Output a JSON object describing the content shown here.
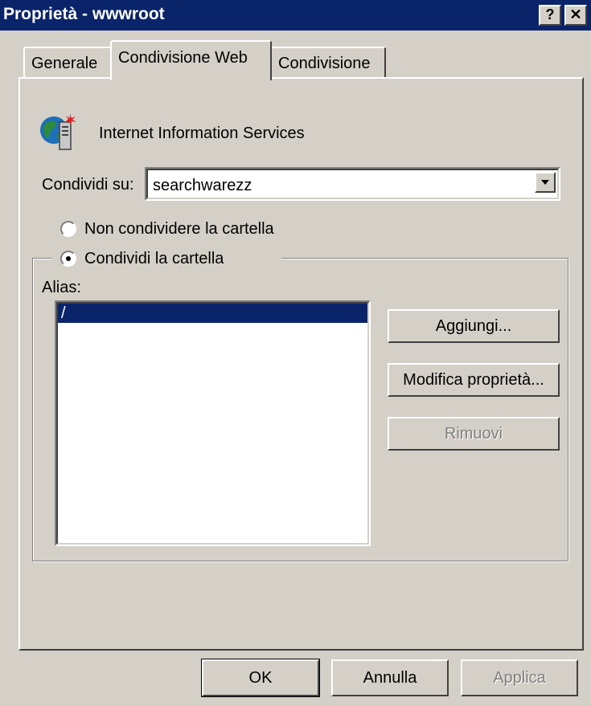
{
  "window": {
    "title": "Proprietà - wwwroot",
    "help_label": "?",
    "close_label": "✕"
  },
  "tabs": [
    {
      "label": "Generale"
    },
    {
      "label": "Condivisione Web",
      "active": true
    },
    {
      "label": "Condivisione"
    }
  ],
  "service": {
    "icon": "iis-globe-server-icon",
    "name": "Internet Information Services"
  },
  "share_on": {
    "label": "Condividi su:",
    "value": "searchwarezz"
  },
  "sharing": {
    "option_no_share": "Non condividere la cartella",
    "option_share": "Condividi la cartella",
    "selected": "share"
  },
  "aliases": {
    "label": "Alias:",
    "items": [
      "/"
    ],
    "selected_index": 0
  },
  "alias_buttons": {
    "add": "Aggiungi...",
    "edit": "Modifica proprietà...",
    "remove": "Rimuovi"
  },
  "footer": {
    "ok": "OK",
    "cancel": "Annulla",
    "apply": "Applica"
  },
  "colors": {
    "titlebar": "#0a246a",
    "selection": "#0a246a",
    "face": "#d4d0c8"
  }
}
